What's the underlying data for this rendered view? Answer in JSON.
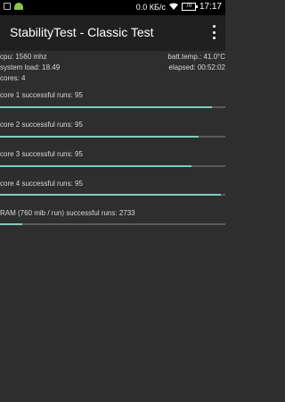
{
  "status_bar": {
    "network_speed": "0.0 КБ/с",
    "battery_level": "70",
    "time": "17:17"
  },
  "app_bar": {
    "title": "StabilityTest - Classic Test"
  },
  "info": {
    "cpu": "cpu: 1560 mhz",
    "batt_temp": "batt.temp.: 41.0°C",
    "system_load": "system load: 18.49",
    "elapsed": "elapsed: 00:52:02",
    "cores": "cores: 4"
  },
  "tests": [
    {
      "label": "core 1 successful runs: 95",
      "progress": 0.94
    },
    {
      "label": "core 2 successful runs: 95",
      "progress": 0.88
    },
    {
      "label": "core 3 successful runs: 95",
      "progress": 0.85
    },
    {
      "label": "core 4 successful runs: 95",
      "progress": 0.98
    },
    {
      "label": "RAM (760 mib / run) successful runs: 2733",
      "progress": 0.1
    }
  ],
  "colors": {
    "accent": "#80cbc4",
    "background": "#2e2e2e",
    "track": "#5a5a5a"
  }
}
